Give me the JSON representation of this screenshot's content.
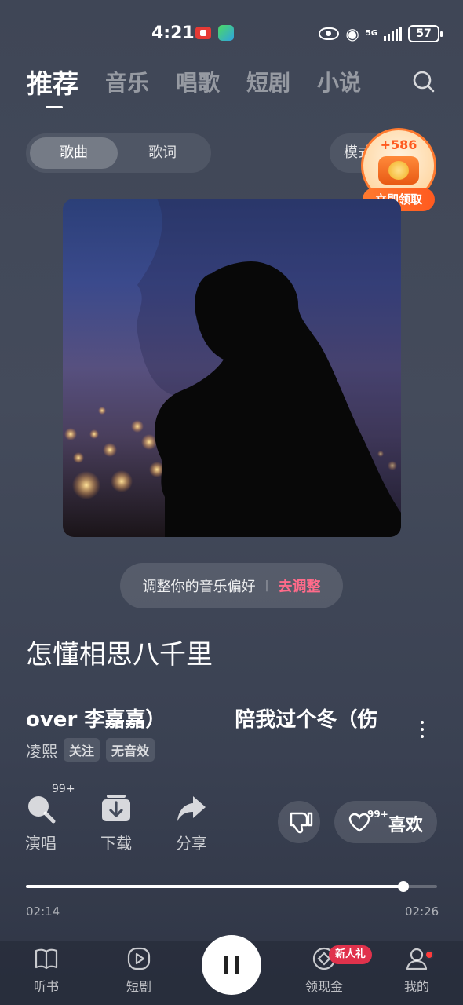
{
  "status_bar": {
    "time": "4:21",
    "net_label": "5G",
    "battery": "57"
  },
  "tabs": [
    {
      "label": "推荐"
    },
    {
      "label": "音乐"
    },
    {
      "label": "唱歌"
    },
    {
      "label": "短剧"
    },
    {
      "label": "小说"
    }
  ],
  "segment": {
    "song": "歌曲",
    "lyrics": "歌词"
  },
  "mode_button": "模式",
  "reward": {
    "amount": "+586",
    "cta": "立即领取"
  },
  "preference": {
    "text": "调整你的音乐偏好",
    "sep": "|",
    "action": "去调整"
  },
  "song": {
    "title": "怎懂相思八千里",
    "subtitle_scroll": [
      "over 李嘉嘉）",
      "陪我过个冬（伤"
    ],
    "artist": "凌熙",
    "follow": "关注",
    "effect": "无音效"
  },
  "actions": {
    "sing": {
      "label": "演唱",
      "count": "99+"
    },
    "download": {
      "label": "下载"
    },
    "share": {
      "label": "分享"
    },
    "like": {
      "label": "喜欢",
      "count": "99+"
    }
  },
  "progress": {
    "current": "02:14",
    "total": "02:26",
    "fraction": 0.9178
  },
  "bottom_nav": {
    "audiobook": "听书",
    "shortdrama": "短剧",
    "cash": "领现金",
    "cash_badge": "新人礼",
    "mine": "我的"
  },
  "colors": {
    "accent_pink": "#ff6b8a",
    "reward_orange": "#ff5a1f",
    "badge_red": "#e0324c"
  }
}
